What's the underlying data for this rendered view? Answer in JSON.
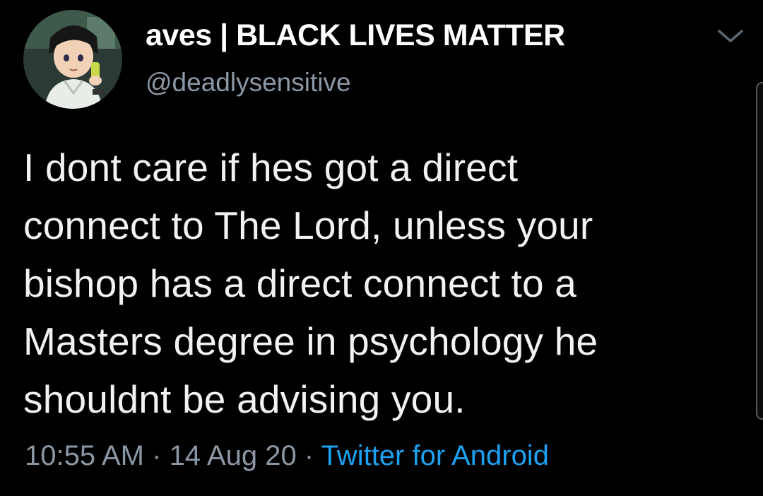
{
  "user": {
    "display_name": "aves | BLACK LIVES MATTER",
    "handle": "@deadlysensitive"
  },
  "tweet": {
    "text": "I dont care if hes got a direct\nconnect to The Lord, unless your\nbishop has a direct connect to a\nMasters degree in psychology he\nshouldnt be advising you."
  },
  "meta": {
    "time": "10:55 AM",
    "separator": " · ",
    "date": "14 Aug 20",
    "source": "Twitter for Android"
  },
  "colors": {
    "background": "#000000",
    "text": "#f2f2f2",
    "muted": "#8b98a5",
    "link": "#1da1f2"
  },
  "icons": {
    "menu": "chevron-down-icon",
    "avatar": "avatar-image"
  }
}
